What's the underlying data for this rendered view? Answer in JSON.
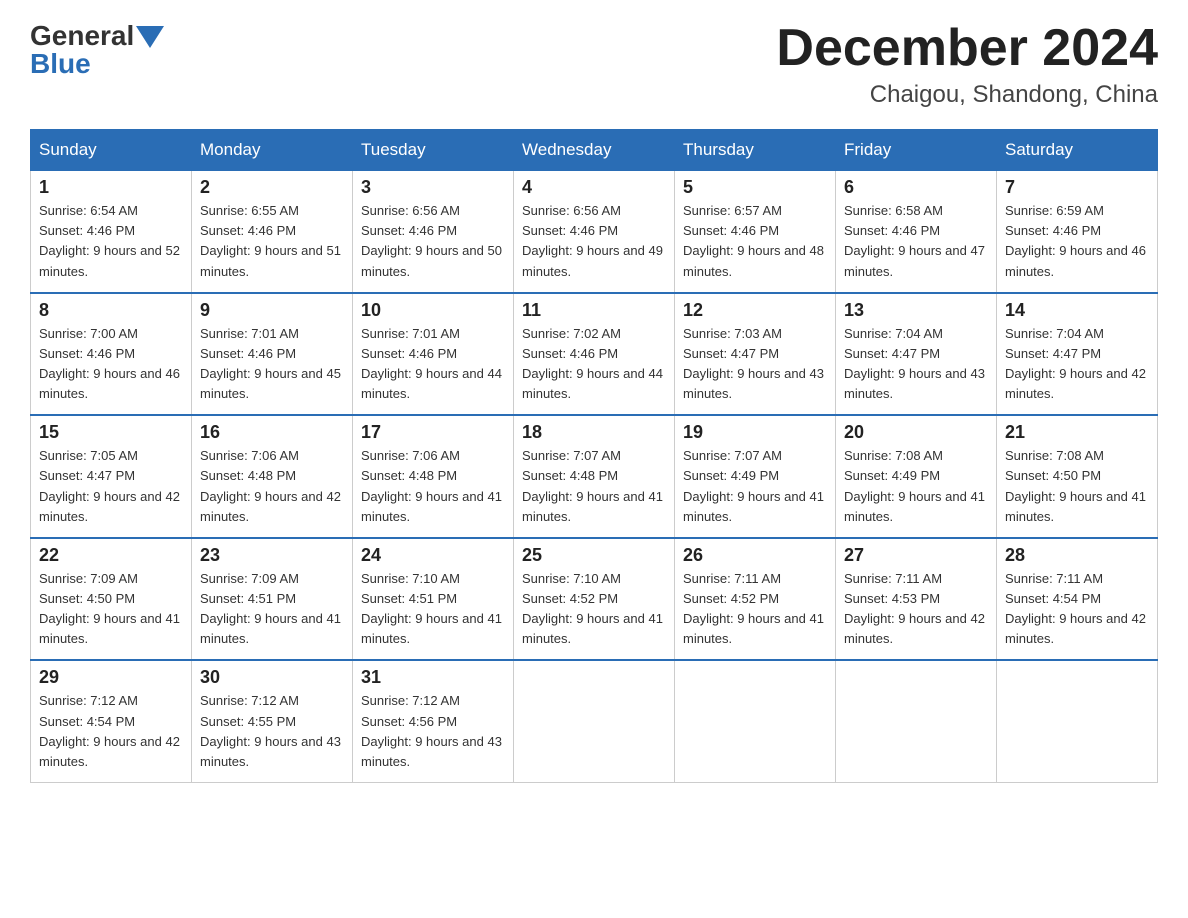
{
  "header": {
    "logo_general": "General",
    "logo_blue": "Blue",
    "month_title": "December 2024",
    "location": "Chaigou, Shandong, China"
  },
  "days_of_week": [
    "Sunday",
    "Monday",
    "Tuesday",
    "Wednesday",
    "Thursday",
    "Friday",
    "Saturday"
  ],
  "weeks": [
    [
      {
        "day": "1",
        "sunrise": "6:54 AM",
        "sunset": "4:46 PM",
        "daylight": "9 hours and 52 minutes."
      },
      {
        "day": "2",
        "sunrise": "6:55 AM",
        "sunset": "4:46 PM",
        "daylight": "9 hours and 51 minutes."
      },
      {
        "day": "3",
        "sunrise": "6:56 AM",
        "sunset": "4:46 PM",
        "daylight": "9 hours and 50 minutes."
      },
      {
        "day": "4",
        "sunrise": "6:56 AM",
        "sunset": "4:46 PM",
        "daylight": "9 hours and 49 minutes."
      },
      {
        "day": "5",
        "sunrise": "6:57 AM",
        "sunset": "4:46 PM",
        "daylight": "9 hours and 48 minutes."
      },
      {
        "day": "6",
        "sunrise": "6:58 AM",
        "sunset": "4:46 PM",
        "daylight": "9 hours and 47 minutes."
      },
      {
        "day": "7",
        "sunrise": "6:59 AM",
        "sunset": "4:46 PM",
        "daylight": "9 hours and 46 minutes."
      }
    ],
    [
      {
        "day": "8",
        "sunrise": "7:00 AM",
        "sunset": "4:46 PM",
        "daylight": "9 hours and 46 minutes."
      },
      {
        "day": "9",
        "sunrise": "7:01 AM",
        "sunset": "4:46 PM",
        "daylight": "9 hours and 45 minutes."
      },
      {
        "day": "10",
        "sunrise": "7:01 AM",
        "sunset": "4:46 PM",
        "daylight": "9 hours and 44 minutes."
      },
      {
        "day": "11",
        "sunrise": "7:02 AM",
        "sunset": "4:46 PM",
        "daylight": "9 hours and 44 minutes."
      },
      {
        "day": "12",
        "sunrise": "7:03 AM",
        "sunset": "4:47 PM",
        "daylight": "9 hours and 43 minutes."
      },
      {
        "day": "13",
        "sunrise": "7:04 AM",
        "sunset": "4:47 PM",
        "daylight": "9 hours and 43 minutes."
      },
      {
        "day": "14",
        "sunrise": "7:04 AM",
        "sunset": "4:47 PM",
        "daylight": "9 hours and 42 minutes."
      }
    ],
    [
      {
        "day": "15",
        "sunrise": "7:05 AM",
        "sunset": "4:47 PM",
        "daylight": "9 hours and 42 minutes."
      },
      {
        "day": "16",
        "sunrise": "7:06 AM",
        "sunset": "4:48 PM",
        "daylight": "9 hours and 42 minutes."
      },
      {
        "day": "17",
        "sunrise": "7:06 AM",
        "sunset": "4:48 PM",
        "daylight": "9 hours and 41 minutes."
      },
      {
        "day": "18",
        "sunrise": "7:07 AM",
        "sunset": "4:48 PM",
        "daylight": "9 hours and 41 minutes."
      },
      {
        "day": "19",
        "sunrise": "7:07 AM",
        "sunset": "4:49 PM",
        "daylight": "9 hours and 41 minutes."
      },
      {
        "day": "20",
        "sunrise": "7:08 AM",
        "sunset": "4:49 PM",
        "daylight": "9 hours and 41 minutes."
      },
      {
        "day": "21",
        "sunrise": "7:08 AM",
        "sunset": "4:50 PM",
        "daylight": "9 hours and 41 minutes."
      }
    ],
    [
      {
        "day": "22",
        "sunrise": "7:09 AM",
        "sunset": "4:50 PM",
        "daylight": "9 hours and 41 minutes."
      },
      {
        "day": "23",
        "sunrise": "7:09 AM",
        "sunset": "4:51 PM",
        "daylight": "9 hours and 41 minutes."
      },
      {
        "day": "24",
        "sunrise": "7:10 AM",
        "sunset": "4:51 PM",
        "daylight": "9 hours and 41 minutes."
      },
      {
        "day": "25",
        "sunrise": "7:10 AM",
        "sunset": "4:52 PM",
        "daylight": "9 hours and 41 minutes."
      },
      {
        "day": "26",
        "sunrise": "7:11 AM",
        "sunset": "4:52 PM",
        "daylight": "9 hours and 41 minutes."
      },
      {
        "day": "27",
        "sunrise": "7:11 AM",
        "sunset": "4:53 PM",
        "daylight": "9 hours and 42 minutes."
      },
      {
        "day": "28",
        "sunrise": "7:11 AM",
        "sunset": "4:54 PM",
        "daylight": "9 hours and 42 minutes."
      }
    ],
    [
      {
        "day": "29",
        "sunrise": "7:12 AM",
        "sunset": "4:54 PM",
        "daylight": "9 hours and 42 minutes."
      },
      {
        "day": "30",
        "sunrise": "7:12 AM",
        "sunset": "4:55 PM",
        "daylight": "9 hours and 43 minutes."
      },
      {
        "day": "31",
        "sunrise": "7:12 AM",
        "sunset": "4:56 PM",
        "daylight": "9 hours and 43 minutes."
      },
      null,
      null,
      null,
      null
    ]
  ]
}
